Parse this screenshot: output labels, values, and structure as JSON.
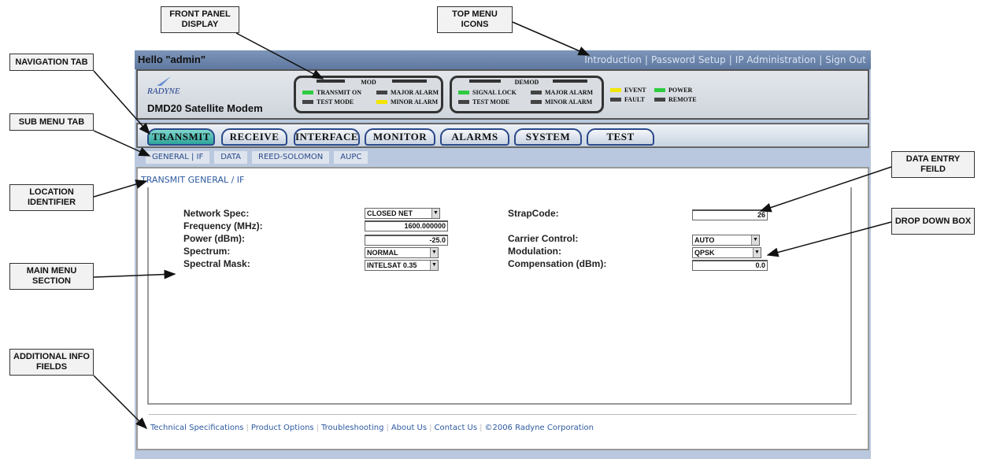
{
  "callouts": {
    "front_panel": "FRONT PANEL DISPLAY",
    "top_menu": "TOP MENU ICONS",
    "nav_tab": "NAVIGATION TAB",
    "sub_menu": "SUB MENU TAB",
    "location": "LOCATION IDENTIFIER",
    "main_menu": "MAIN MENU SECTION",
    "additional": "ADDITIONAL INFO FIELDS",
    "data_entry": "DATA ENTRY FEILD",
    "drop_down": "DROP DOWN BOX"
  },
  "header": {
    "greeting": "Hello \"admin\"",
    "top_menu": [
      "Introduction",
      "Password Setup",
      "IP Administration",
      "Sign Out"
    ]
  },
  "panel": {
    "logo": "RADYNE",
    "model": "DMD20 Satellite Modem",
    "mod": {
      "title": "MOD",
      "leds": [
        {
          "label": "TRANSMIT ON",
          "color": "green"
        },
        {
          "label": "MAJOR ALARM",
          "color": "gray"
        },
        {
          "label": "TEST MODE",
          "color": "gray"
        },
        {
          "label": "MINOR ALARM",
          "color": "yellow"
        }
      ]
    },
    "demod": {
      "title": "DEMOD",
      "leds": [
        {
          "label": "SIGNAL LOCK",
          "color": "green"
        },
        {
          "label": "MAJOR ALARM",
          "color": "gray"
        },
        {
          "label": "TEST MODE",
          "color": "gray"
        },
        {
          "label": "MINOR ALARM",
          "color": "gray"
        }
      ]
    },
    "status": [
      {
        "label": "EVENT",
        "color": "yellow"
      },
      {
        "label": "POWER",
        "color": "green"
      },
      {
        "label": "FAULT",
        "color": "gray"
      },
      {
        "label": "REMOTE",
        "color": "gray"
      }
    ]
  },
  "nav": {
    "tabs": [
      "TRANSMIT",
      "RECEIVE",
      "INTERFACE",
      "MONITOR",
      "ALARMS",
      "SYSTEM",
      "TEST"
    ],
    "active": "TRANSMIT"
  },
  "subnav": {
    "tabs": [
      "GENERAL | IF",
      "DATA",
      "REED-SOLOMON",
      "AUPC"
    ]
  },
  "location": "TRANSMIT GENERAL / IF",
  "form": {
    "network_spec_label": "Network Spec:",
    "network_spec_value": "CLOSED NET",
    "frequency_label": "Frequency (MHz):",
    "frequency_value": "1600.000000",
    "power_label": "Power (dBm):",
    "power_value": "-25.0",
    "spectrum_label": "Spectrum:",
    "spectrum_value": "NORMAL",
    "spectral_mask_label": "Spectral Mask:",
    "spectral_mask_value": "INTELSAT 0.35",
    "strapcode_label": "StrapCode:",
    "strapcode_value": "26",
    "carrier_control_label": "Carrier Control:",
    "carrier_control_value": "AUTO",
    "modulation_label": "Modulation:",
    "modulation_value": "QPSK",
    "compensation_label": "Compensation (dBm):",
    "compensation_value": "0.0"
  },
  "footer": {
    "links": [
      "Technical Specifications",
      "Product Options",
      "Troubleshooting",
      "About Us",
      "Contact Us",
      "©2006 Radyne Corporation"
    ]
  },
  "colors": {
    "led_green": "#2ecc40",
    "led_yellow": "#f2e600",
    "link_blue": "#2d5aa0",
    "active_tab": "#2fa59b"
  }
}
